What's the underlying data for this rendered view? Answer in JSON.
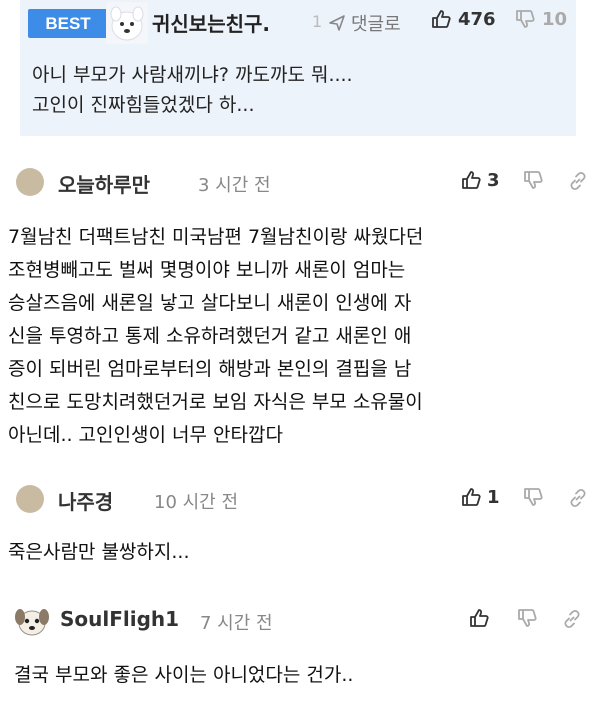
{
  "best_comment": {
    "badge": "BEST",
    "author": "귀신보는친구.",
    "truncated_fragment": "1",
    "reply_label": "댓글로",
    "likes": "476",
    "dislikes": "10",
    "text_lines": [
      "아니 부모가 사람새끼냐? 까도까도 뭐....",
      "고인이 진짜힘들었겠다 하..."
    ]
  },
  "comments": [
    {
      "author": "오늘하루만",
      "time": "3 시간 전",
      "likes": "3",
      "text_lines": [
        "7월남친 더팩트남친 미국남편 7월남친이랑 싸웠다던",
        "조현병빼고도 벌써 몇명이야 보니까 새론이 엄마는",
        "승살즈음에 새론일 낳고 살다보니 새론이 인생에 자",
        "신을 투영하고 통제 소유하려했던거 같고 새론인 애",
        "증이 되버린 엄마로부터의 해방과 본인의 결핍을 남",
        "친으로 도망치려했던거로 보임 자식은 부모 소유물이",
        "아닌데.. 고인인생이 너무 안타깝다"
      ]
    },
    {
      "author": "나주경",
      "time": "10 시간 전",
      "likes": "1",
      "text_lines": [
        "죽은사람만 불쌍하지..."
      ]
    },
    {
      "author": "SoulFligh1",
      "time": "7 시간 전",
      "likes": "",
      "text_lines": [
        "결국 부모와 좋은 사이는 아니었다는 건가.."
      ]
    }
  ],
  "icons": {
    "like": "thumbs-up-icon",
    "dislike": "thumbs-down-icon",
    "share": "link-icon",
    "reply": "reply-arrow-icon"
  },
  "colors": {
    "best_badge": "#3d8de8",
    "best_background": "#edf3fb",
    "default_avatar": "#c9bba2"
  }
}
